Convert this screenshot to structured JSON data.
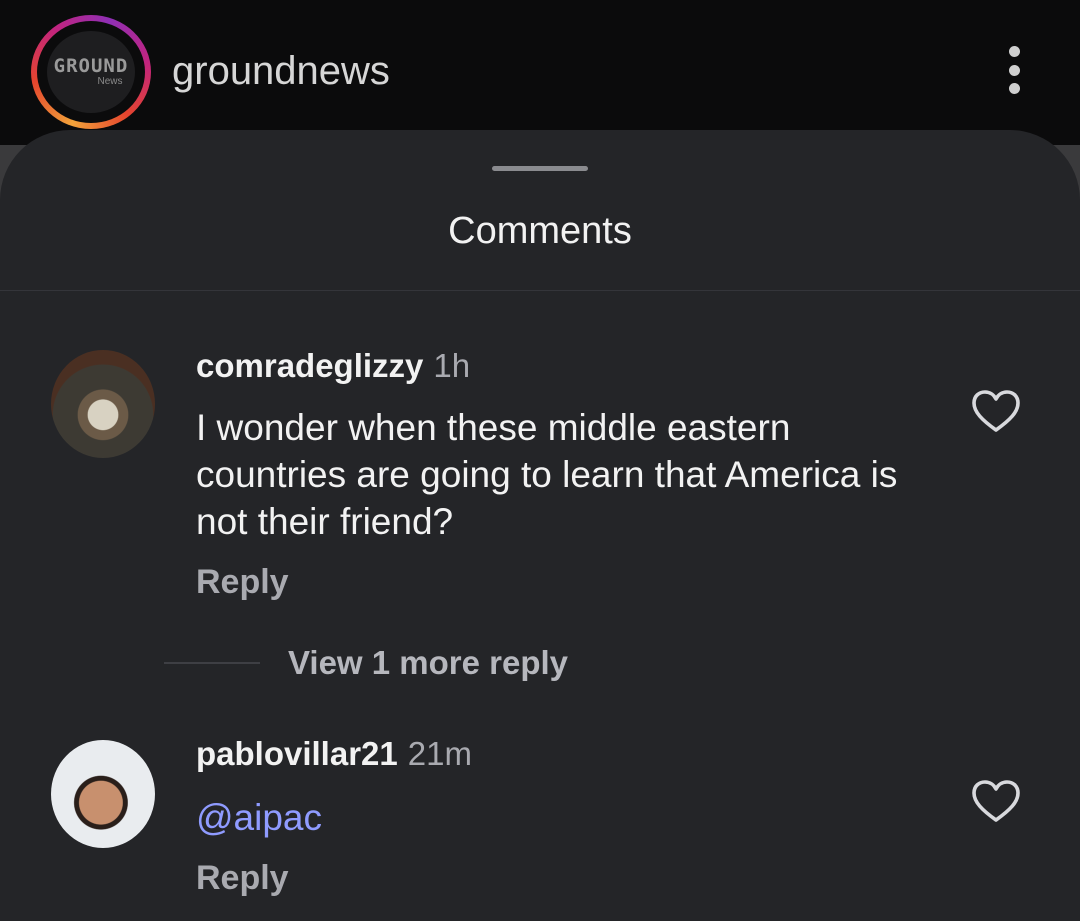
{
  "header": {
    "account_name": "groundnews",
    "logo_text": "GROUND",
    "logo_subtext": "News",
    "more_icon": "more-vertical-icon"
  },
  "sheet": {
    "title": "Comments"
  },
  "comments": [
    {
      "username": "comradeglizzy",
      "time": "1h",
      "text": "I wonder when these middle eastern countries are going to learn that America is not their friend?",
      "reply_label": "Reply",
      "like_icon": "heart-outline-icon",
      "view_replies_label": "View 1 more reply"
    },
    {
      "username": "pablovillar21",
      "time": "21m",
      "text": "@aipac",
      "reply_label": "Reply",
      "like_icon": "heart-outline-icon"
    }
  ],
  "colors": {
    "sheet_background": "#242528",
    "mention": "#8f9bff",
    "secondary_text": "#a9aab0"
  }
}
